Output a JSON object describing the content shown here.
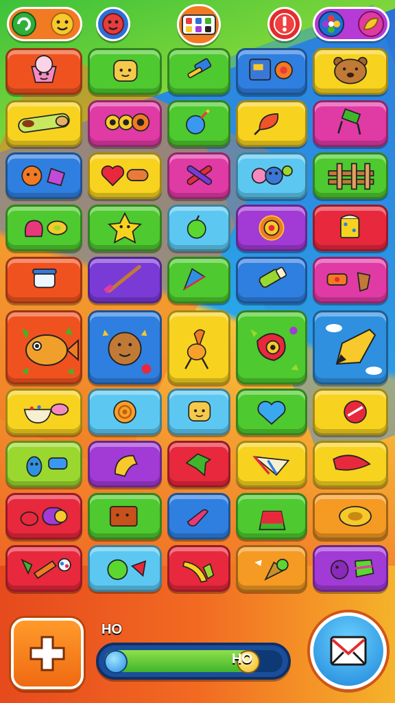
{
  "topbar": {
    "left_pill": {
      "icons": [
        "green-swirl-icon",
        "smiley-sun-icon"
      ],
      "color": "#f27a22"
    },
    "red_face_button": {
      "icon": "red-face-icon",
      "color": "#e83c3c"
    },
    "center_badge": {
      "icon": "dice-collection-icon",
      "color": "#f27a22"
    },
    "alert_button": {
      "icon": "exclamation-icon",
      "color": "#e32d2d"
    },
    "right_pill": {
      "icons": [
        "flower-icon",
        "leaf-icon"
      ],
      "color": "#b53ad6"
    }
  },
  "board": {
    "columns": 5,
    "rows": [
      [
        {
          "name": "cupcake-icon",
          "color": "#f0521f"
        },
        {
          "name": "toast-face-icon",
          "color": "#4ec92f"
        },
        {
          "name": "hammer-icon",
          "color": "#4ec92f"
        },
        {
          "name": "book-and-cookie-icon",
          "color": "#2f7fe0"
        },
        {
          "name": "bear-face-icon",
          "color": "#f7d21f"
        }
      ],
      [
        {
          "name": "sandwich-roll-icon",
          "color": "#f7d21f"
        },
        {
          "name": "goggles-icon",
          "color": "#e03aa5"
        },
        {
          "name": "blue-bomb-icon",
          "color": "#4ec92f"
        },
        {
          "name": "red-leaf-icon",
          "color": "#f7d21f"
        },
        {
          "name": "green-chair-icon",
          "color": "#e03aa5"
        }
      ],
      [
        {
          "name": "orange-creature-icon",
          "color": "#2f7fe0"
        },
        {
          "name": "heart-and-pill-icon",
          "color": "#f7d21f"
        },
        {
          "name": "crossed-crayons-icon",
          "color": "#e03aa5"
        },
        {
          "name": "blob-creatures-icon",
          "color": "#5cc8f2"
        },
        {
          "name": "wooden-fence-icon",
          "color": "#4ec92f"
        }
      ],
      [
        {
          "name": "strawberry-and-ring-icon",
          "color": "#4ec92f"
        },
        {
          "name": "star-face-icon",
          "color": "#4ec92f"
        },
        {
          "name": "green-apple-icon",
          "color": "#5cc8f2"
        },
        {
          "name": "sun-disc-icon",
          "color": "#a23ad6"
        },
        {
          "name": "cheese-block-icon",
          "color": "#e8283c"
        }
      ],
      [
        {
          "name": "orange-blank-icon",
          "color": "#f0521f"
        },
        {
          "name": "jar-icon",
          "color": "#f0521f"
        },
        {
          "name": "magic-wand-icon",
          "color": "#7a3ad6"
        },
        {
          "name": "paper-kite-icon",
          "color": "#4ec92f"
        },
        {
          "name": "glue-stick-icon",
          "color": "#2f7fe0"
        },
        {
          "name": "candy-and-shell-icon",
          "color": "#e03aa5"
        }
      ],
      [
        {
          "name": "fish-leaf-icon",
          "color": "#f0521f",
          "big": true
        },
        {
          "name": "gingerbread-star-icon",
          "color": "#2f7fe0",
          "big": true
        },
        {
          "name": "trophy-spoon-icon",
          "color": "#f7d21f",
          "big": true
        },
        {
          "name": "bird-flower-icon",
          "color": "#4ec92f",
          "big": true
        },
        {
          "name": "pencil-sky-icon",
          "color": "#2f90e0",
          "big": true
        }
      ],
      [
        {
          "name": "bowl-spoon-icon",
          "color": "#f7d21f"
        },
        {
          "name": "snail-icon",
          "color": "#5cc8f2"
        },
        {
          "name": "pink-toaster-icon",
          "color": "#5cc8f2"
        },
        {
          "name": "blue-heart-icon",
          "color": "#4ec92f"
        },
        {
          "name": "red-donut-icon",
          "color": "#f7d21f"
        }
      ],
      [
        {
          "name": "bottle-and-cap-icon",
          "color": "#9ad82f"
        },
        {
          "name": "yellow-wedge-icon",
          "color": "#a23ad6"
        },
        {
          "name": "green-arrow-icon",
          "color": "#e8283c"
        },
        {
          "name": "ribbon-sail-icon",
          "color": "#f7d21f"
        },
        {
          "name": "red-fish-icon",
          "color": "#f7d21f"
        }
      ],
      [
        {
          "name": "tomato-and-roll-icon",
          "color": "#e8283c"
        },
        {
          "name": "brick-face-icon",
          "color": "#4ec92f"
        },
        {
          "name": "boot-icon",
          "color": "#2f7fe0"
        },
        {
          "name": "watermelon-slice-icon",
          "color": "#4ec92f"
        },
        {
          "name": "gold-ring-icon",
          "color": "#f59a22"
        }
      ],
      [
        {
          "name": "carrot-leaf-icon",
          "color": "#e8283c"
        },
        {
          "name": "green-pea-icon",
          "color": "#5cc8f2"
        },
        {
          "name": "banana-icon",
          "color": "#e8283c"
        },
        {
          "name": "ice-cream-cone-icon",
          "color": "#f59a22"
        },
        {
          "name": "plum-and-gem-icon",
          "color": "#a23ad6"
        }
      ]
    ]
  },
  "bottom": {
    "add_button_icon": "plus-icon",
    "small_label": "HO",
    "progress": {
      "value_text": "HO",
      "fill": 0.86
    },
    "corner_button_icon": "envelope-icon"
  }
}
